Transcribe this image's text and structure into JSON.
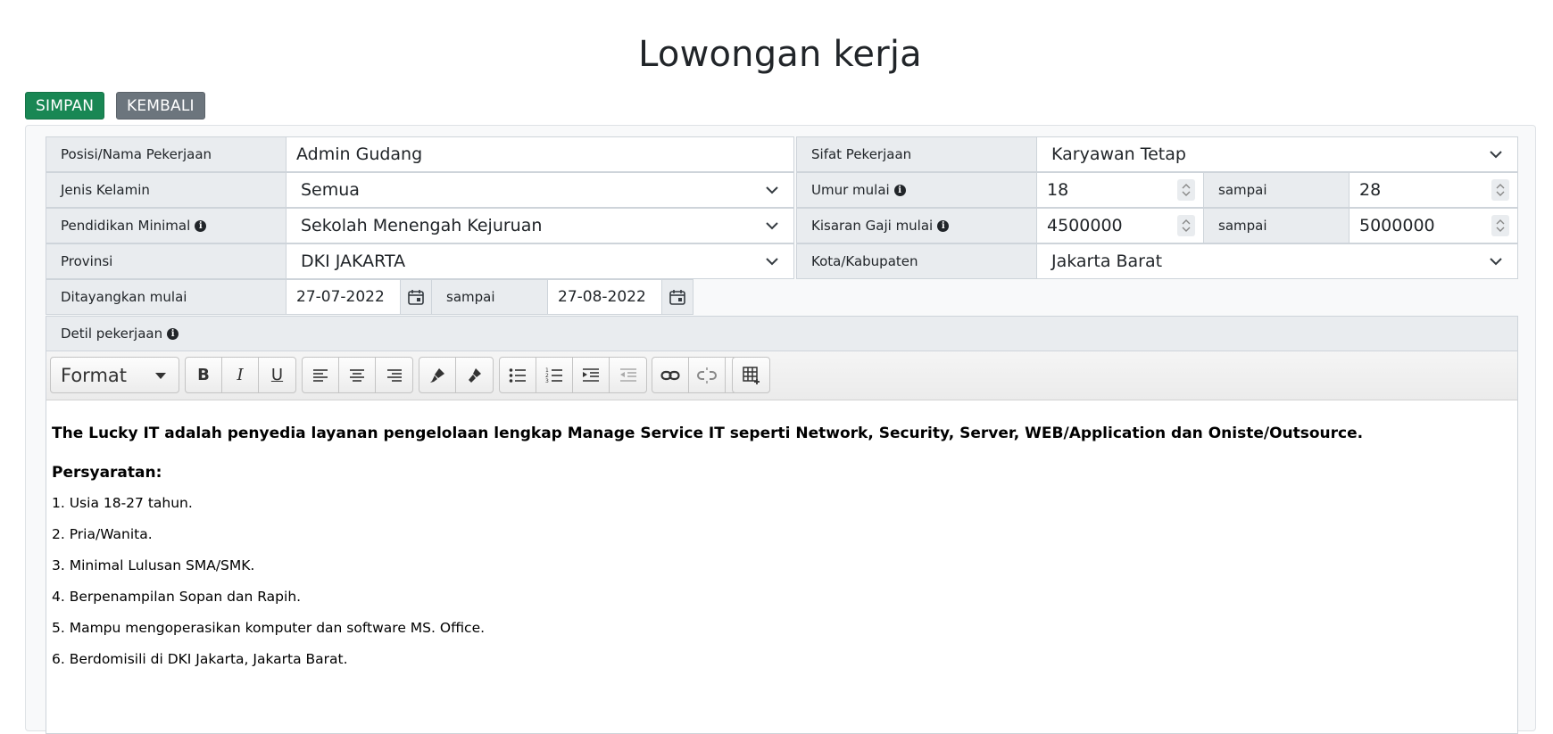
{
  "page": {
    "title": "Lowongan kerja"
  },
  "actions": {
    "save_label": "SIMPAN",
    "back_label": "KEMBALI",
    "save_color": "#198754",
    "back_color": "#6c757d"
  },
  "form": {
    "position": {
      "label": "Posisi/Nama Pekerjaan",
      "value": "Admin Gudang"
    },
    "job_type": {
      "label": "Sifat Pekerjaan",
      "value": "Karyawan Tetap"
    },
    "gender": {
      "label": "Jenis Kelamin",
      "value": "Semua"
    },
    "age": {
      "label": "Umur mulai",
      "from": "18",
      "to_label": "sampai",
      "to": "28"
    },
    "education": {
      "label": "Pendidikan Minimal",
      "value": "Sekolah Menengah Kejuruan"
    },
    "salary": {
      "label": "Kisaran Gaji mulai",
      "from": "4500000",
      "to_label": "sampai",
      "to": "5000000"
    },
    "province": {
      "label": "Provinsi",
      "value": "DKI JAKARTA"
    },
    "city": {
      "label": "Kota/Kabupaten",
      "value": "Jakarta Barat"
    },
    "published": {
      "label": "Ditayangkan mulai",
      "from": "27-07-2022",
      "to_label": "sampai",
      "to": "27-08-2022"
    },
    "detail": {
      "label": "Detil pekerjaan"
    }
  },
  "editor": {
    "format_label": "Format",
    "toolbar_icons": [
      "bold-icon",
      "italic-icon",
      "underline-icon",
      "align-left-icon",
      "align-center-icon",
      "align-right-icon",
      "paint-format-icon",
      "clear-format-icon",
      "bullet-list-icon",
      "numbered-list-icon",
      "indent-icon",
      "outdent-icon",
      "link-icon",
      "unlink-icon",
      "image-icon",
      "table-icon"
    ],
    "bold_label": "B",
    "italic_label": "I",
    "underline_label": "U",
    "intro": "The Lucky IT adalah penyedia layanan pengelolaan lengkap Manage Service IT seperti Network, Security, Server, WEB/Application dan Oniste/Outsource.",
    "requirements_title": "Persyaratan:",
    "requirements": [
      "1. Usia 18-27 tahun.",
      "2. Pria/Wanita.",
      "3. Minimal Lulusan SMA/SMK.",
      "4. Berpenampilan Sopan dan Rapih.",
      "5. Mampu mengoperasikan komputer dan software MS. Office.",
      "6. Berdomisili di DKI Jakarta, Jakarta Barat."
    ]
  }
}
